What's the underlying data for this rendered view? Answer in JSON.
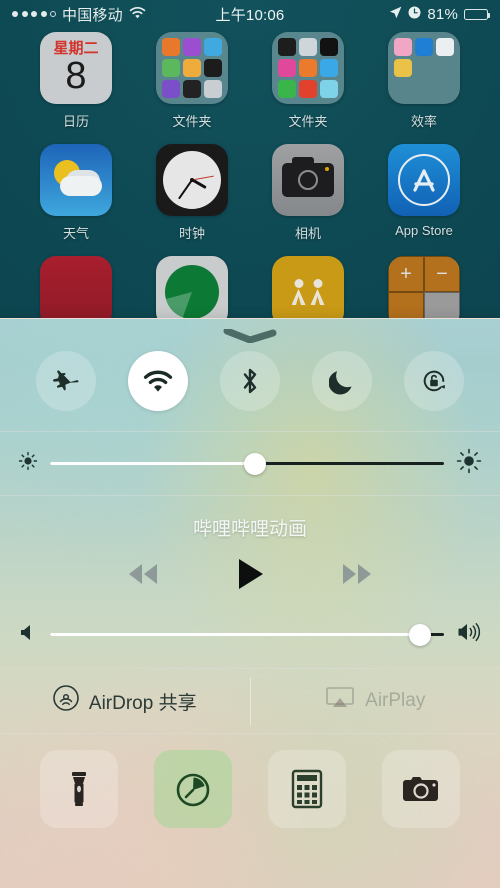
{
  "status_bar": {
    "signal_dots_filled": 4,
    "signal_dots_total": 5,
    "carrier": "中国移动",
    "wifi_icon": "wifi-icon",
    "time": "上午10:06",
    "location_icon": "location-arrow-icon",
    "alarm_icon": "alarm-clock-icon",
    "battery_percent": "81%",
    "battery_level": 81
  },
  "home_screen": {
    "apps": [
      {
        "label": "日历",
        "icon": "calendar-icon",
        "day_of_week": "星期二",
        "day": "8"
      },
      {
        "label": "文件夹",
        "icon": "folder-icon"
      },
      {
        "label": "文件夹",
        "icon": "folder-icon"
      },
      {
        "label": "效率",
        "icon": "folder-icon"
      },
      {
        "label": "天气",
        "icon": "weather-icon"
      },
      {
        "label": "时钟",
        "icon": "clock-icon"
      },
      {
        "label": "相机",
        "icon": "camera-icon"
      },
      {
        "label": "App Store",
        "icon": "app-store-icon"
      }
    ],
    "partial_row": [
      {
        "icon": "red-card-app-icon"
      },
      {
        "icon": "radar-app-icon"
      },
      {
        "icon": "people-app-icon"
      },
      {
        "icon": "calculator-grid-app-icon"
      }
    ]
  },
  "control_center": {
    "grabber": "chevron-down-grabber",
    "toggles": [
      {
        "name": "airplane-mode",
        "icon": "airplane-icon",
        "active": false
      },
      {
        "name": "wifi",
        "icon": "wifi-icon",
        "active": true
      },
      {
        "name": "bluetooth",
        "icon": "bluetooth-icon",
        "active": false
      },
      {
        "name": "do-not-disturb",
        "icon": "moon-icon",
        "active": false
      },
      {
        "name": "rotation-lock",
        "icon": "rotation-lock-icon",
        "active": false
      }
    ],
    "brightness": {
      "label": "brightness-slider",
      "value": 52,
      "min_icon": "sun-small-icon",
      "max_icon": "sun-large-icon"
    },
    "media": {
      "track_title": "哔哩哔哩动画",
      "previous_label": "previous-track",
      "play_label": "play",
      "next_label": "next-track",
      "is_playing": false
    },
    "volume": {
      "label": "volume-slider",
      "value": 94,
      "min_icon": "speaker-mute-icon",
      "max_icon": "speaker-wave-icon"
    },
    "share": {
      "airdrop_label": "AirDrop 共享",
      "airdrop_icon": "airdrop-icon",
      "airdrop_enabled": true,
      "airplay_label": "AirPlay",
      "airplay_icon": "airplay-icon",
      "airplay_enabled": false
    },
    "shortcuts": [
      {
        "name": "flashlight",
        "icon": "flashlight-icon",
        "active": false
      },
      {
        "name": "timer",
        "icon": "timer-icon",
        "active": true
      },
      {
        "name": "calculator",
        "icon": "calculator-icon",
        "active": false
      },
      {
        "name": "camera",
        "icon": "camera-icon",
        "active": false
      }
    ]
  },
  "colors": {
    "wallpaper": "#0e4a54",
    "panel_top": "#a8cfd2",
    "panel_bottom": "#e3cdbf",
    "active_toggle": "#ffffff",
    "slider_fill": "#ffffff",
    "slider_track": "#17211f"
  }
}
